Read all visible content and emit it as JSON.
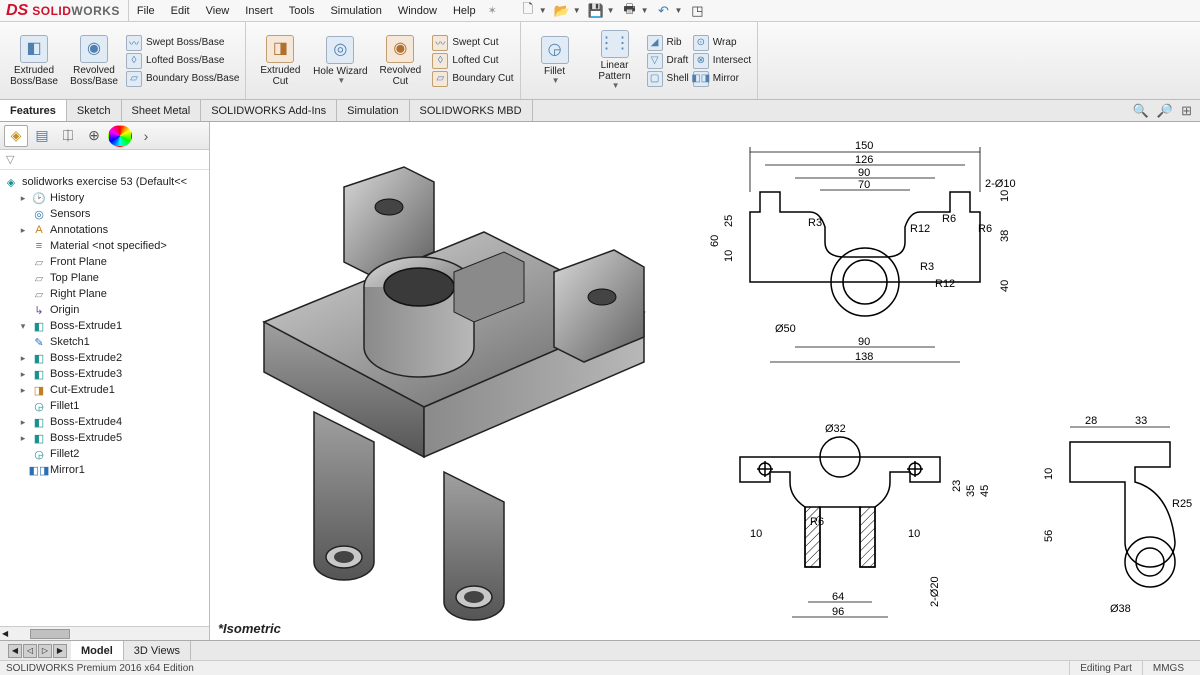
{
  "app": {
    "logo1": "SOLID",
    "logo2": "WORKS"
  },
  "menu": {
    "file": "File",
    "edit": "Edit",
    "view": "View",
    "insert": "Insert",
    "tools": "Tools",
    "simulation": "Simulation",
    "window": "Window",
    "help": "Help"
  },
  "ribbon": {
    "extruded_boss": "Extruded Boss/Base",
    "revolved_boss": "Revolved Boss/Base",
    "swept_boss": "Swept Boss/Base",
    "lofted_boss": "Lofted Boss/Base",
    "boundary_boss": "Boundary Boss/Base",
    "extruded_cut": "Extruded Cut",
    "hole_wizard": "Hole Wizard",
    "revolved_cut": "Revolved Cut",
    "swept_cut": "Swept Cut",
    "lofted_cut": "Lofted Cut",
    "boundary_cut": "Boundary Cut",
    "fillet": "Fillet",
    "linear_pattern": "Linear Pattern",
    "rib": "Rib",
    "draft": "Draft",
    "shell": "Shell",
    "wrap": "Wrap",
    "intersect": "Intersect",
    "mirror": "Mirror"
  },
  "feature_tabs": {
    "features": "Features",
    "sketch": "Sketch",
    "sheet_metal": "Sheet Metal",
    "addins": "SOLIDWORKS Add-Ins",
    "simulation": "Simulation",
    "mbd": "SOLIDWORKS MBD"
  },
  "tree": {
    "root": "solidworks exercise 53  (Default<<",
    "history": "History",
    "sensors": "Sensors",
    "annotations": "Annotations",
    "material": "Material <not specified>",
    "front": "Front Plane",
    "top": "Top Plane",
    "right": "Right Plane",
    "origin": "Origin",
    "be1": "Boss-Extrude1",
    "sketch1": "Sketch1",
    "be2": "Boss-Extrude2",
    "be3": "Boss-Extrude3",
    "ce1": "Cut-Extrude1",
    "fillet1": "Fillet1",
    "be4": "Boss-Extrude4",
    "be5": "Boss-Extrude5",
    "fillet2": "Fillet2",
    "mirror1": "Mirror1"
  },
  "viewport": {
    "label": "*Isometric"
  },
  "bottom_tabs": {
    "model": "Model",
    "views3d": "3D Views"
  },
  "status": {
    "edition": "SOLIDWORKS Premium 2016 x64 Edition",
    "mode": "Editing Part",
    "units": "MMGS"
  },
  "dims": {
    "top": {
      "d150": "150",
      "d126": "126",
      "d90a": "90",
      "d70": "70",
      "diam10": "2-Ø10",
      "d60": "60",
      "d25": "25",
      "d10a": "10",
      "d10b": "10",
      "d38": "38",
      "d40": "40",
      "r3a": "R3",
      "r3b": "R3",
      "r12a": "R12",
      "r12b": "R12",
      "r6a": "R6",
      "r6b": "R6",
      "diam50": "Ø50",
      "d90b": "90",
      "d138": "138"
    },
    "front": {
      "diam32": "Ø32",
      "d23": "23",
      "d35": "35",
      "d45": "45",
      "r6": "R6",
      "d10a": "10",
      "d10b": "10",
      "d64": "64",
      "d96": "96",
      "diam20": "2-Ø20"
    },
    "side": {
      "d28": "28",
      "d33": "33",
      "d10": "10",
      "d56": "56",
      "r25": "R25",
      "diam38": "Ø38"
    }
  }
}
